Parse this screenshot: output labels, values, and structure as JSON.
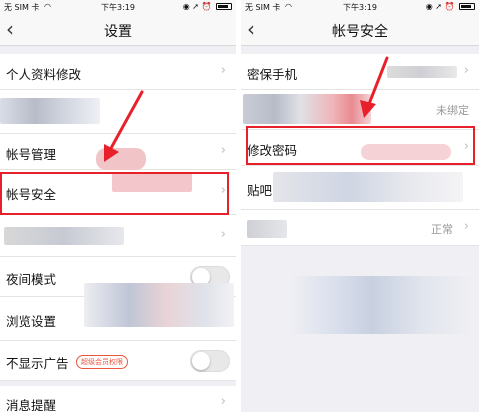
{
  "status_bar": {
    "carrier": "无 SIM 卡",
    "time": "下午3:19"
  },
  "left_screen": {
    "title": "设置",
    "items": [
      {
        "label": "个人资料修改"
      },
      {
        "label": "帐号管理"
      },
      {
        "label": "帐号安全"
      },
      {
        "label": "夜间模式"
      },
      {
        "label": "浏览设置"
      },
      {
        "label": "不显示广告",
        "badge": "超级会员权限"
      },
      {
        "label": "消息提醒"
      }
    ]
  },
  "right_screen": {
    "title": "帐号安全",
    "items": [
      {
        "label": "密保手机"
      },
      {
        "label": "",
        "value": "未绑定"
      },
      {
        "label": "修改密码"
      },
      {
        "label": "贴吧"
      },
      {
        "label": "",
        "value": "正常"
      }
    ]
  },
  "colors": {
    "highlight": "#e8202a",
    "background": "#efeff4"
  },
  "icons": {
    "back": "chevron-left-icon",
    "disclosure": "chevron-right-icon"
  }
}
